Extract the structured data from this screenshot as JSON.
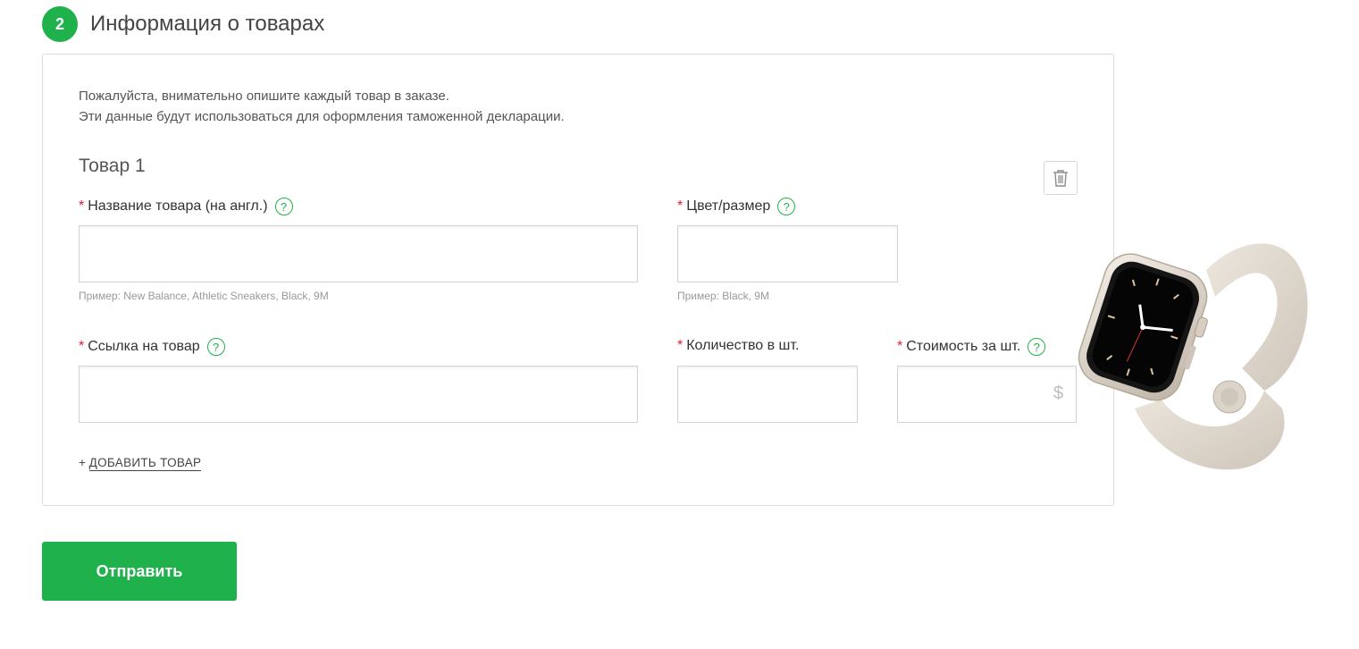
{
  "step": {
    "number": "2",
    "title": "Информация о товарах"
  },
  "intro": {
    "line1": "Пожалуйста, внимательно опишите каждый товар в заказе.",
    "line2": "Эти данные будут использоваться для оформления таможенной декларации."
  },
  "item": {
    "title": "Товар 1",
    "fields": {
      "name": {
        "required_mark": "*",
        "label": "Название товара (на англ.)",
        "help": "?",
        "value": "",
        "hint": "Пример: New Balance, Athletic Sneakers, Black, 9M"
      },
      "color_size": {
        "required_mark": "*",
        "label": "Цвет/размер",
        "help": "?",
        "value": "",
        "hint": "Пример: Black, 9M"
      },
      "link": {
        "required_mark": "*",
        "label": "Ссылка на товар",
        "help": "?",
        "value": ""
      },
      "quantity": {
        "required_mark": "*",
        "label": "Количество в шт.",
        "value": ""
      },
      "price": {
        "required_mark": "*",
        "label": "Стоимость за шт.",
        "help": "?",
        "value": "",
        "currency": "$"
      }
    }
  },
  "add_item": {
    "plus": "+",
    "label": "ДОБАВИТЬ ТОВАР"
  },
  "submit": {
    "label": "Отправить"
  },
  "icons": {
    "delete": "trash-icon",
    "help": "help-icon",
    "product_image": "smartwatch-image"
  },
  "colors": {
    "accent": "#1fb14b",
    "required": "#e0202b"
  }
}
